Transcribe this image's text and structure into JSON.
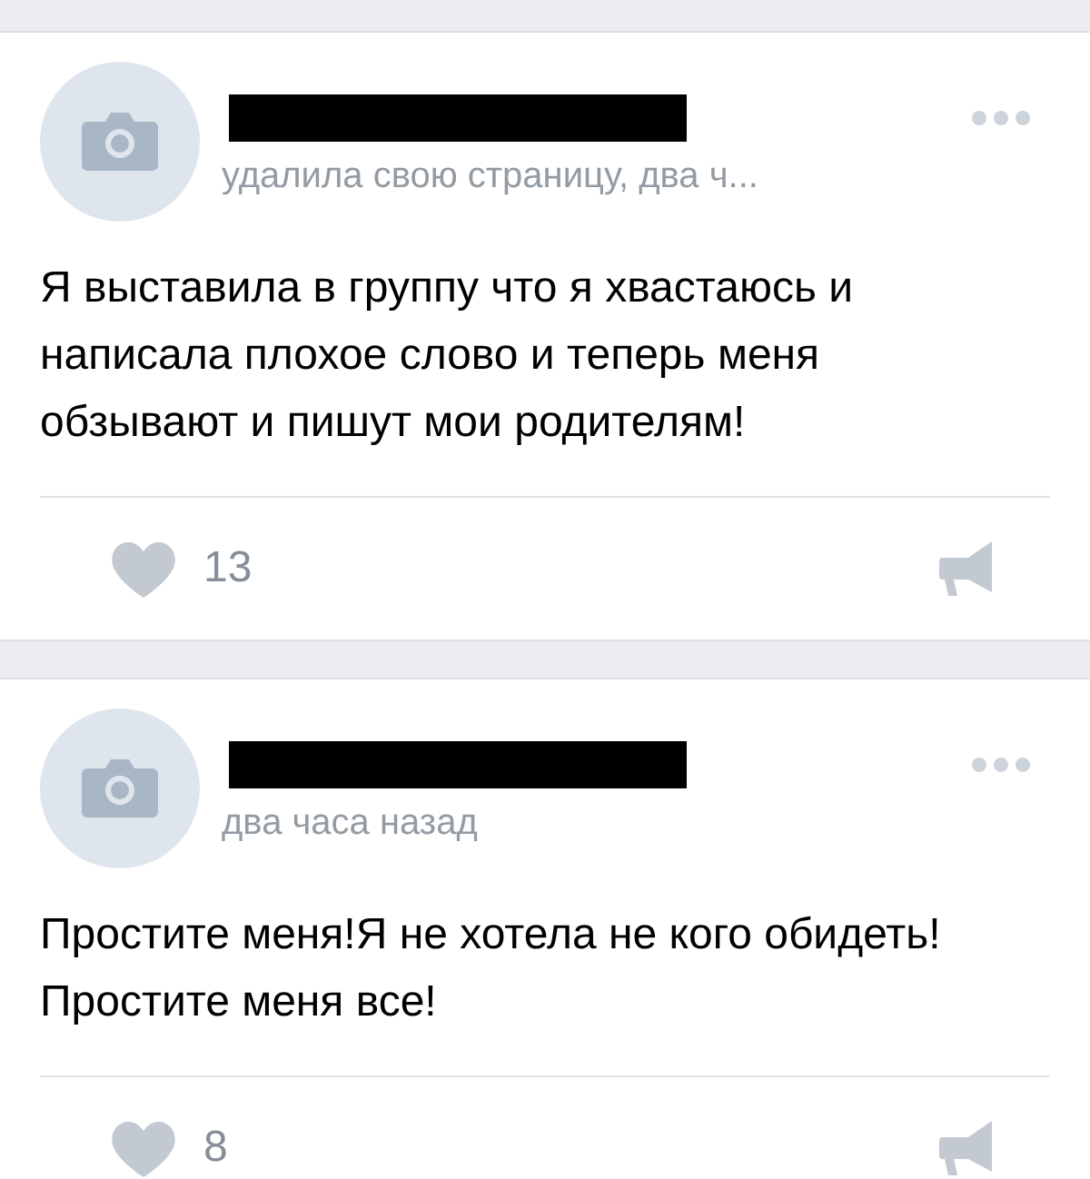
{
  "posts": [
    {
      "subtitle": "удалила свою страницу, два ч...",
      "text": "Я выставила в группу что я хвастаюсь и написала плохое слово и теперь меня обзывают и пишут мои родителям!",
      "likes": "13"
    },
    {
      "subtitle": "два часа назад",
      "text": "Простите меня!Я не хотела не кого обидеть!Простите меня все!",
      "likes": "8"
    }
  ]
}
